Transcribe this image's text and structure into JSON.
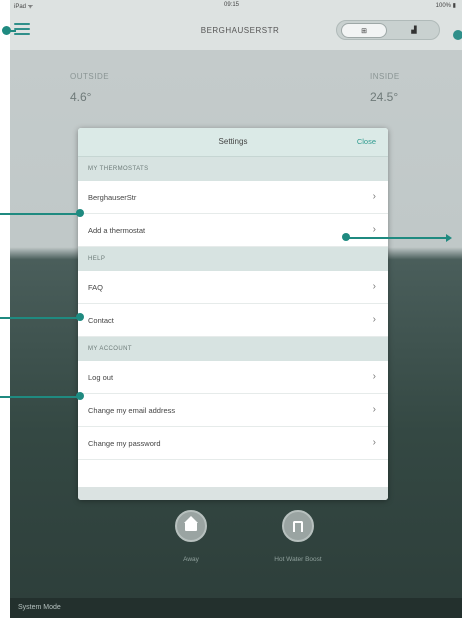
{
  "status_bar": {
    "carrier": "iPad ᯤ",
    "time": "09:15",
    "battery": "100% ▮"
  },
  "header": {
    "location_title": "BERGHAUSERSTR",
    "view_grid": "⊞",
    "view_chart": "▟"
  },
  "readings": {
    "outside_label": "OUTSIDE",
    "outside_value": "4.6°",
    "inside_label": "INSIDE",
    "inside_value": "24.5°"
  },
  "settings": {
    "title": "Settings",
    "close_label": "Close",
    "sections": [
      {
        "label": "MY THERMOSTATS",
        "rows": [
          "BerghauserStr",
          "Add a thermostat"
        ]
      },
      {
        "label": "HELP",
        "rows": [
          "FAQ",
          "Contact"
        ]
      },
      {
        "label": "MY ACCOUNT",
        "rows": [
          "Log out",
          "Change my email address",
          "Change my password"
        ]
      }
    ]
  },
  "controls": {
    "away_label": "Away",
    "hot_water_label": "Hot Water Boost"
  },
  "system_bar": {
    "label": "System Mode"
  },
  "colors": {
    "accent": "#1f8a80",
    "modal_header": "#dbeae7",
    "section_bg": "#d7e3e1"
  }
}
